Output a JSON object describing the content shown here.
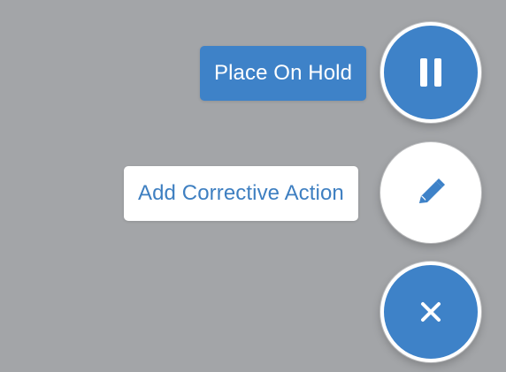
{
  "actions": {
    "hold": {
      "label": "Place On Hold",
      "icon": "pause-icon"
    },
    "corrective": {
      "label": "Add Corrective Action",
      "icon": "pencil-icon"
    },
    "close": {
      "icon": "close-icon"
    }
  },
  "colors": {
    "backdrop": "#a3a5a8",
    "primary": "#3e82c8",
    "white": "#ffffff",
    "secondaryText": "#3e7fc1"
  }
}
